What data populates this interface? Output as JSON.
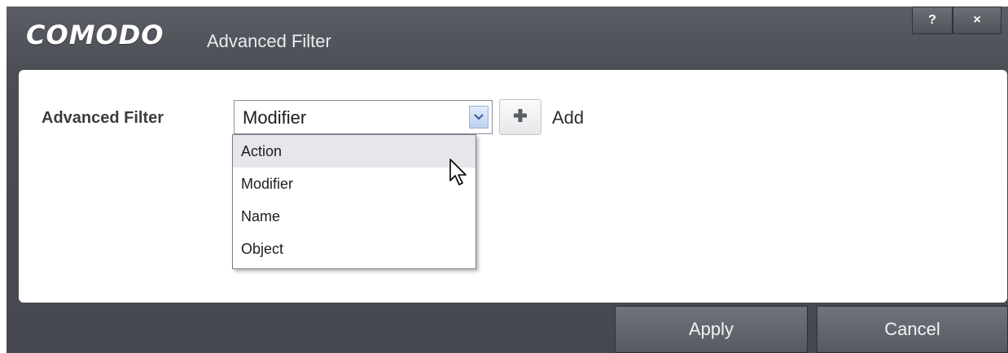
{
  "window": {
    "brand": "COMODO",
    "title": "Advanced Filter",
    "help_label": "?",
    "close_label": "×"
  },
  "filter": {
    "label": "Advanced Filter",
    "selected_value": "Modifier",
    "options": [
      "Action",
      "Modifier",
      "Name",
      "Object"
    ],
    "highlighted_option": "Action",
    "add_label": "Add"
  },
  "footer": {
    "apply_label": "Apply",
    "cancel_label": "Cancel"
  },
  "icons": {
    "dropdown_arrow": "chevron-down-icon",
    "add": "plus-icon",
    "cursor": "mouse-pointer-icon"
  },
  "colors": {
    "titlebar": "#4b4e55",
    "panel": "#ffffff",
    "add_icon": "#5a5d64",
    "dropdown_arrow_bg": "#bfd0ef"
  }
}
